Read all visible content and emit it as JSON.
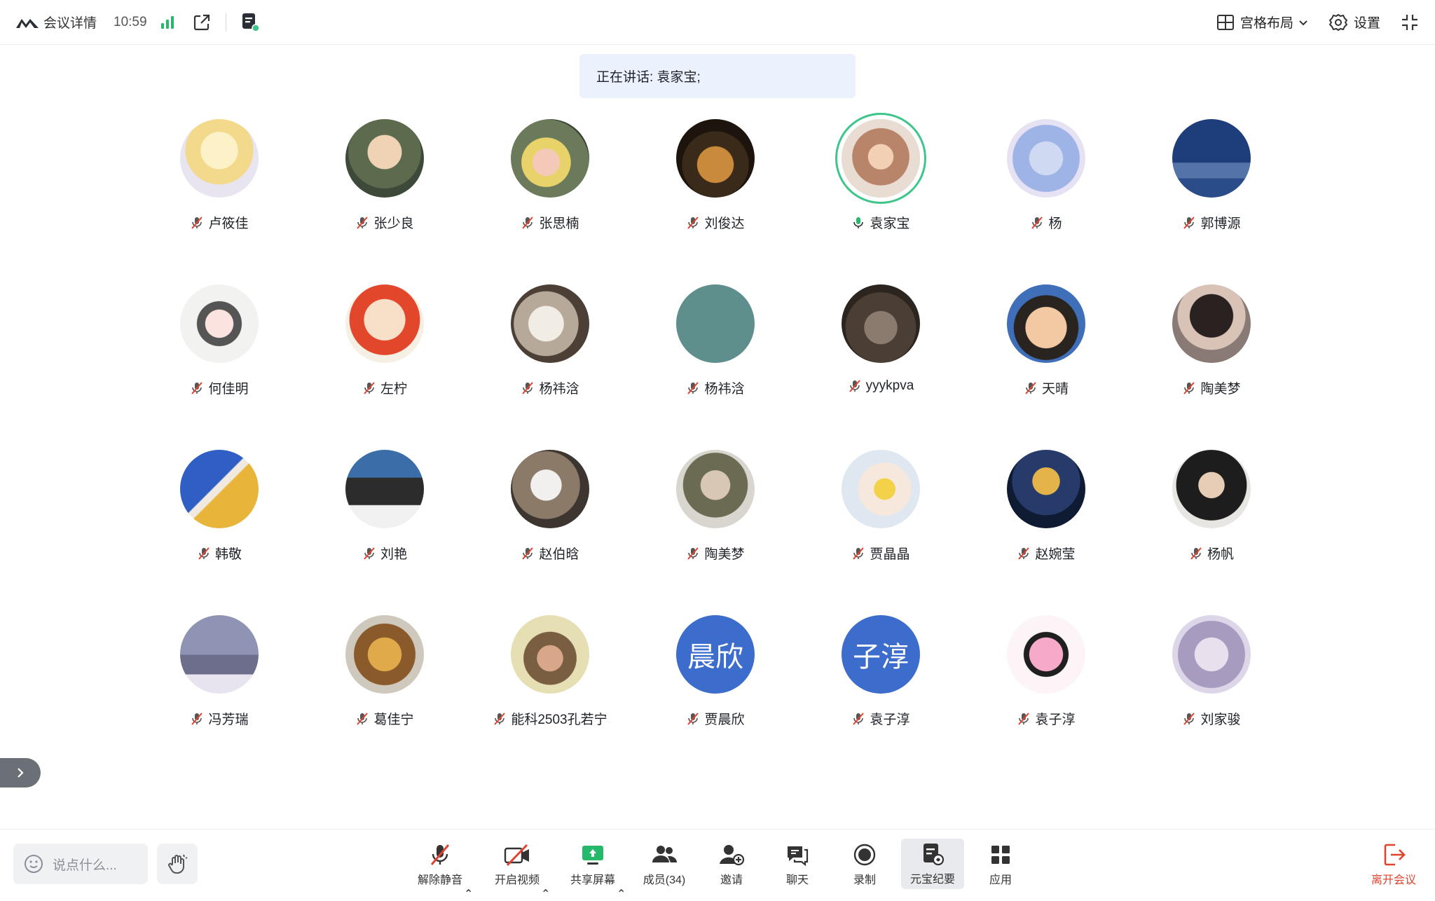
{
  "topbar": {
    "title": "会议详情",
    "time": "10:59",
    "layout_label": "宫格布局",
    "settings_label": "设置"
  },
  "speaking_banner": "正在讲话: 袁家宝;",
  "participants": [
    {
      "name": "卢筱佳",
      "mic": "muted",
      "avatar": "anime-blonde"
    },
    {
      "name": "张少良",
      "mic": "muted",
      "avatar": "bald-baby"
    },
    {
      "name": "张思楠",
      "mic": "muted",
      "avatar": "pig-umbrella"
    },
    {
      "name": "刘俊达",
      "mic": "muted",
      "avatar": "cat-hat"
    },
    {
      "name": "袁家宝",
      "mic": "speaking",
      "avatar": "baby-photo"
    },
    {
      "name": "杨",
      "mic": "muted",
      "avatar": "anime-blue"
    },
    {
      "name": "郭博源",
      "mic": "muted",
      "avatar": "moon-night"
    },
    {
      "name": "何佳明",
      "mic": "muted",
      "avatar": "anime-bw"
    },
    {
      "name": "左柠",
      "mic": "muted",
      "avatar": "cartoon-face"
    },
    {
      "name": "杨祎浛",
      "mic": "muted",
      "avatar": "puppy"
    },
    {
      "name": "杨祎浛",
      "mic": "muted",
      "avatar": "plain-teal"
    },
    {
      "name": "yyykpva",
      "mic": "muted",
      "avatar": "cat-hands"
    },
    {
      "name": "天晴",
      "mic": "muted",
      "avatar": "boy-face"
    },
    {
      "name": "陶美梦",
      "mic": "muted",
      "avatar": "sleeping-girl"
    },
    {
      "name": "韩敬",
      "mic": "muted",
      "avatar": "hexagons"
    },
    {
      "name": "刘艳",
      "mic": "muted",
      "avatar": "girl-sea"
    },
    {
      "name": "赵伯晗",
      "mic": "muted",
      "avatar": "anime-silver"
    },
    {
      "name": "陶美梦",
      "mic": "muted",
      "avatar": "camo-selfie"
    },
    {
      "name": "贾晶晶",
      "mic": "muted",
      "avatar": "girl-sunflower"
    },
    {
      "name": "赵婉莹",
      "mic": "muted",
      "avatar": "anime-dark"
    },
    {
      "name": "杨帆",
      "mic": "muted",
      "avatar": "boy-black"
    },
    {
      "name": "冯芳瑞",
      "mic": "muted",
      "avatar": "misty-person"
    },
    {
      "name": "葛佳宁",
      "mic": "muted",
      "avatar": "dog-costume"
    },
    {
      "name": "能科2503孔若宁",
      "mic": "muted",
      "avatar": "bunny-girl"
    },
    {
      "name": "贾晨欣",
      "mic": "muted",
      "avatar": "text",
      "initials": "晨欣"
    },
    {
      "name": "袁子淳",
      "mic": "muted",
      "avatar": "text",
      "initials": "子淳"
    },
    {
      "name": "袁子淳",
      "mic": "muted",
      "avatar": "pink-anime"
    },
    {
      "name": "刘家骏",
      "mic": "muted",
      "avatar": "anime-boy"
    }
  ],
  "chat_placeholder": "说点什么...",
  "toolbar": {
    "unmute": "解除静音",
    "start_video": "开启视频",
    "share_screen": "共享屏幕",
    "members": "成员(34)",
    "invite": "邀请",
    "chat": "聊天",
    "record": "录制",
    "summary": "元宝纪要",
    "apps": "应用",
    "leave": "离开会议"
  },
  "colors": {
    "accent_green": "#26b96b",
    "speaking_ring": "#3fc58a",
    "banner_bg": "#ebf1fd",
    "text_avatar_blue": "#3c6ccc",
    "leave_red": "#e0442e"
  }
}
